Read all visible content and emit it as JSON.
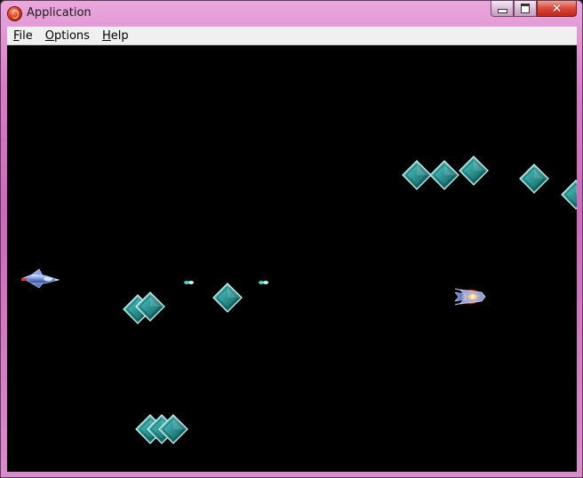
{
  "window": {
    "title": "Application",
    "icon": "app-icon",
    "controls": [
      "minimize-icon",
      "maximize-icon",
      "close-icon"
    ]
  },
  "menu": {
    "file": {
      "first": "F",
      "rest": "ile"
    },
    "options": {
      "first": "O",
      "rest": "ptions"
    },
    "help": {
      "first": "H",
      "rest": "elp"
    }
  },
  "game": {
    "background_color": "#000000",
    "gem_color": "#2a8f8f",
    "entities": {
      "player": "player-ship",
      "enemy": "enemy-ship",
      "projectiles": [
        "plasma-shot",
        "plasma-shot"
      ],
      "gems": "diamond-gem"
    }
  }
}
